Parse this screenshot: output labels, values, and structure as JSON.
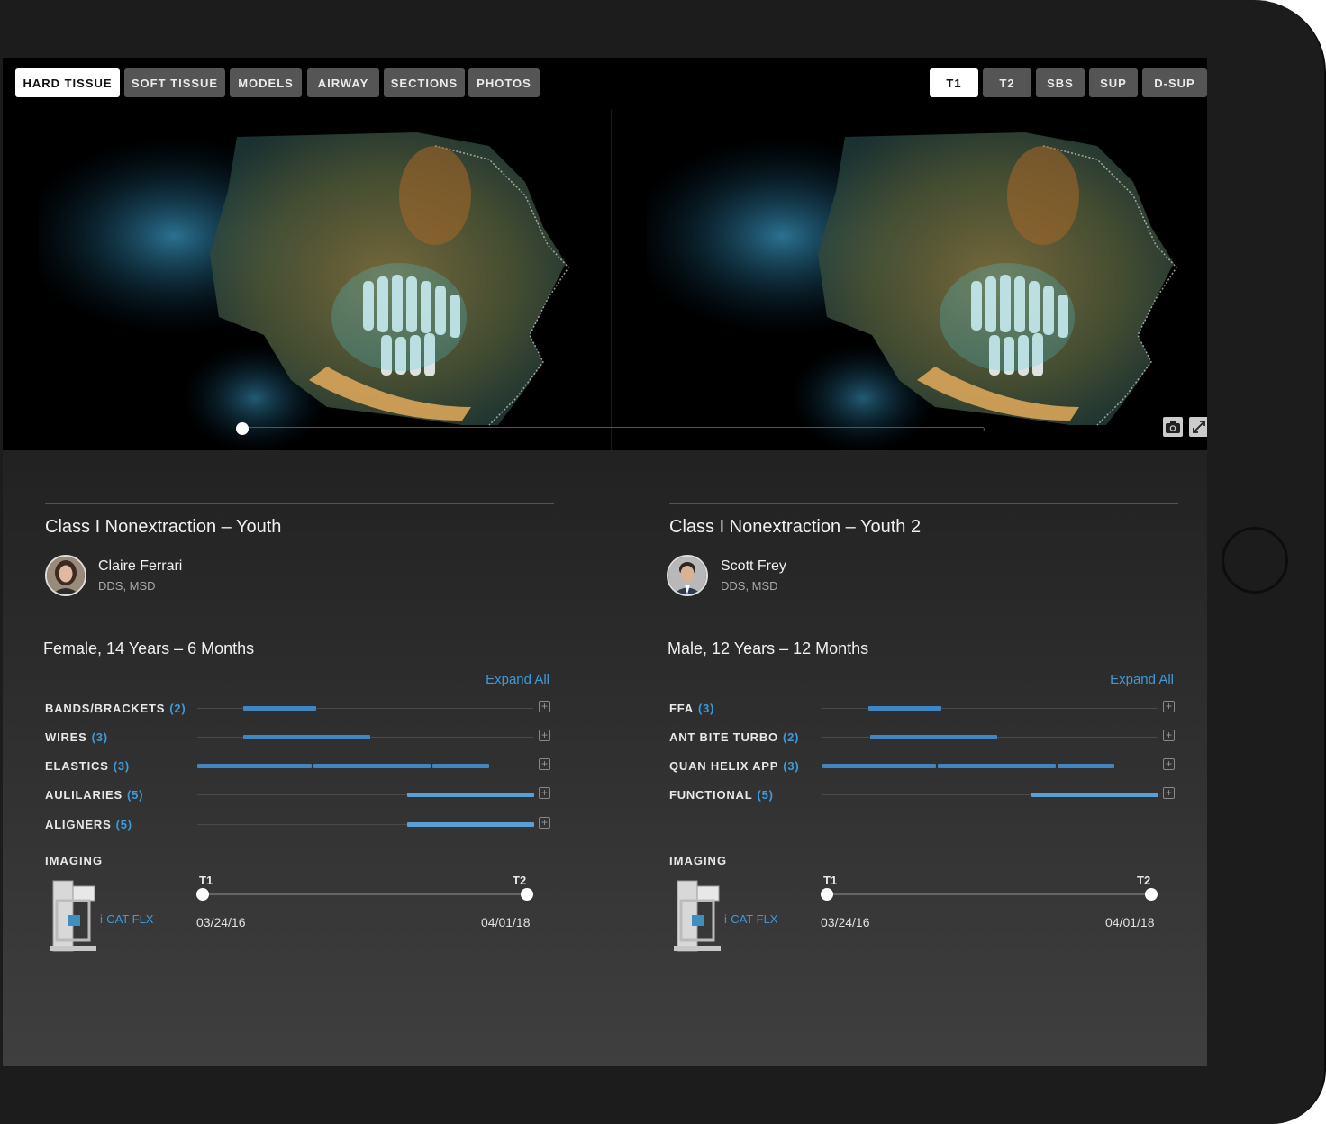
{
  "toolbar": {
    "tabs": [
      "HARD TISSUE",
      "SOFT TISSUE",
      "MODELS",
      "AIRWAY",
      "SECTIONS",
      "PHOTOS"
    ],
    "active_tab": "HARD TISSUE",
    "time_modes": [
      "T1",
      "T2",
      "SBS",
      "SUP",
      "D-SUP"
    ],
    "active_mode": "T1"
  },
  "viewer": {
    "icons": [
      "camera-icon",
      "fullscreen-icon"
    ],
    "scrubber_position": 0
  },
  "left": {
    "title": "Class I Nonextraction – Youth",
    "doctor_name": "Claire Ferrari",
    "doctor_credentials": "DDS, MSD",
    "demographics": "Female, 14 Years – 6 Months",
    "expand_all": "Expand All",
    "treatments": [
      {
        "label": "BANDS/BRACKETS",
        "count": "(2)"
      },
      {
        "label": "WIRES",
        "count": "(3)"
      },
      {
        "label": "ELASTICS",
        "count": "(3)"
      },
      {
        "label": "AULILARIES",
        "count": "(5)"
      },
      {
        "label": "ALIGNERS",
        "count": "(5)"
      }
    ],
    "imaging_label": "IMAGING",
    "imaging_device": "i-CAT FLX",
    "t1_label": "T1",
    "t2_label": "T2",
    "t1_date": "03/24/16",
    "t2_date": "04/01/18"
  },
  "right": {
    "title": "Class I Nonextraction – Youth 2",
    "doctor_name": "Scott Frey",
    "doctor_credentials": "DDS, MSD",
    "demographics": "Male, 12 Years – 12 Months",
    "expand_all": "Expand All",
    "treatments": [
      {
        "label": "FFA",
        "count": "(3)"
      },
      {
        "label": "ANT BITE TURBO",
        "count": "(2)"
      },
      {
        "label": "QUAN HELIX APP",
        "count": "(3)"
      },
      {
        "label": "FUNCTIONAL",
        "count": "(5)"
      }
    ],
    "imaging_label": "IMAGING",
    "imaging_device": "i-CAT FLX",
    "t1_label": "T1",
    "t2_label": "T2",
    "t1_date": "03/24/16",
    "t2_date": "04/01/18"
  },
  "colors": {
    "accent": "#3e9ad9",
    "bar": "#3f86c3",
    "bar_light": "#5aa0d4",
    "active_tab_bg": "#ffffff",
    "tab_bg": "#555555"
  }
}
